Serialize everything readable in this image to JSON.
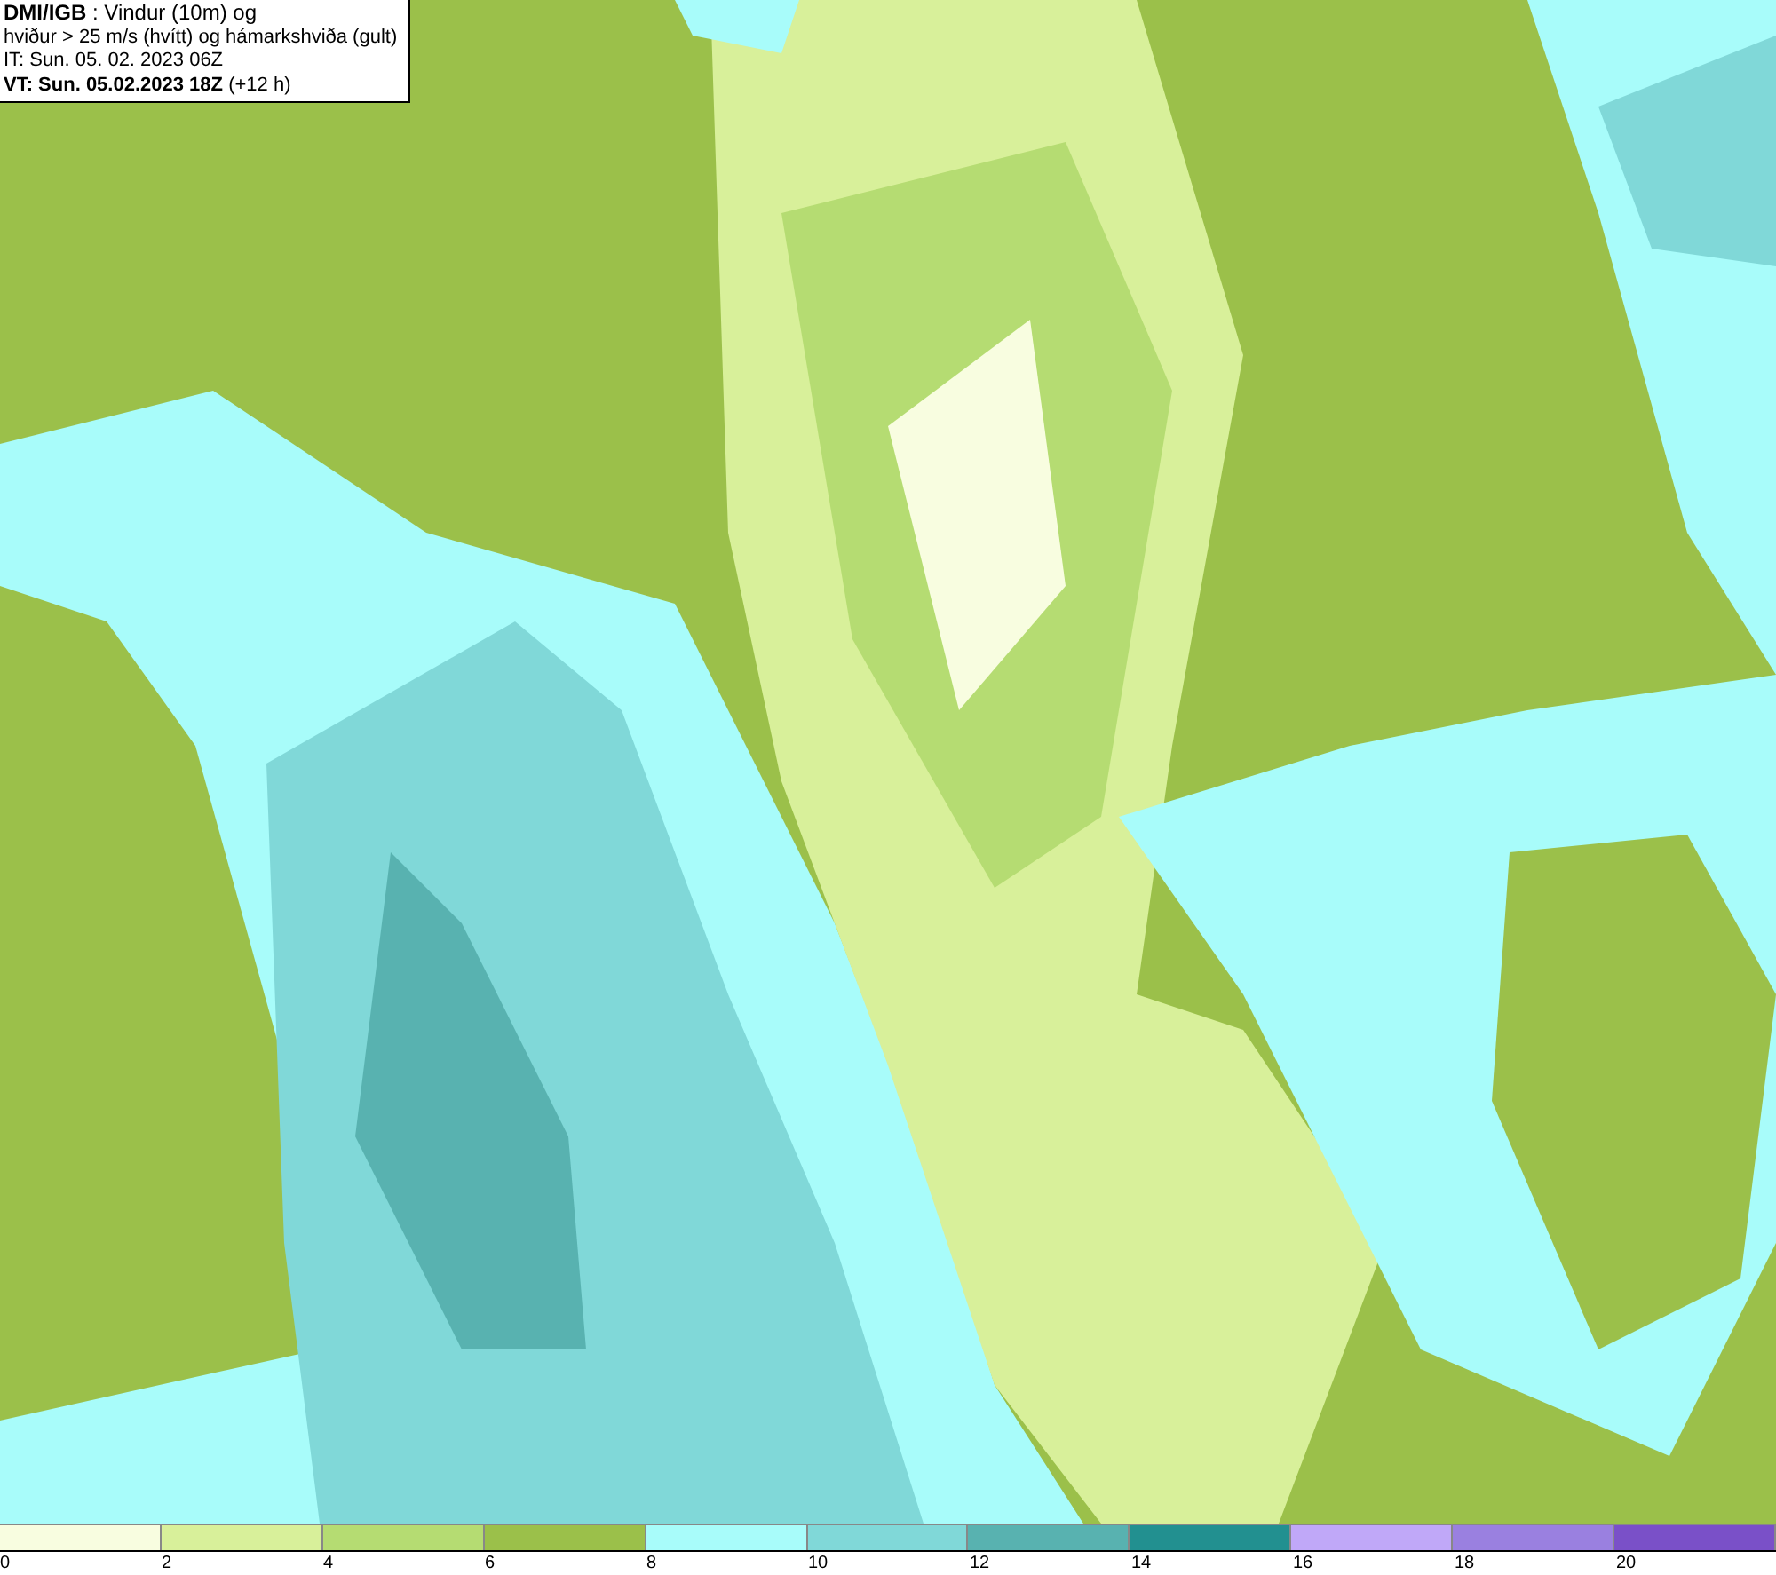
{
  "header": {
    "lines": [
      "**DMI/IGB** : Vindur (10m) og",
      "hviður > 25 m/s (hvítt) og hámarkshviða (gult)",
      "IT: Sun. 05. 02. 2023 06Z",
      "**VT: Sun. 05.02.2023 18Z** (+12 h)"
    ]
  },
  "legend": {
    "segments": [
      {
        "color": "#f8fde0"
      },
      {
        "color": "#d8f09a"
      },
      {
        "color": "#b5dc72"
      },
      {
        "color": "#9bc04a"
      },
      {
        "color": "#a8fcfa"
      },
      {
        "color": "#80d8d8"
      },
      {
        "color": "#58b2b0"
      },
      {
        "color": "#229090"
      },
      {
        "color": "#c0a8f8"
      },
      {
        "color": "#9a80e0"
      },
      {
        "color": "#7a50c8"
      }
    ],
    "labels": [
      "0",
      "2",
      "4",
      "6",
      "8",
      "10",
      "12",
      "14",
      "16",
      "18",
      "20"
    ]
  }
}
